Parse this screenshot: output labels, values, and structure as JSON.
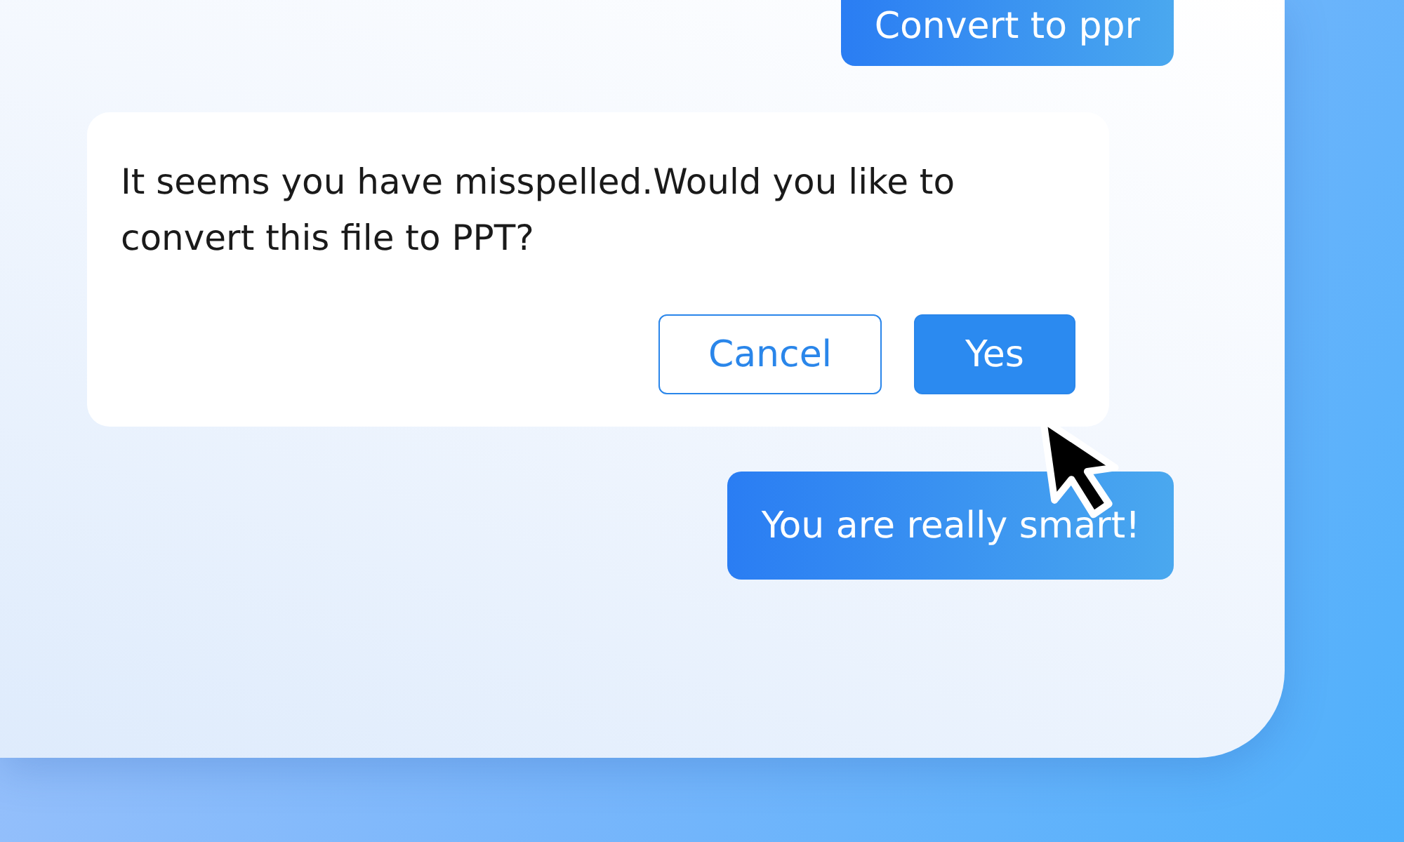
{
  "messages": [
    {
      "kind": "bubble",
      "text": "Convert to ppr",
      "cut_top": true
    },
    {
      "kind": "dialog",
      "text": "It seems you have misspelled.Would you like to convert this file to PPT?",
      "buttons": [
        {
          "label": "Cancel",
          "kind": "secondary"
        },
        {
          "label": "Yes",
          "kind": "primary"
        }
      ]
    },
    {
      "kind": "bubble",
      "text": "You are really smart!",
      "cut_top": false
    }
  ]
}
